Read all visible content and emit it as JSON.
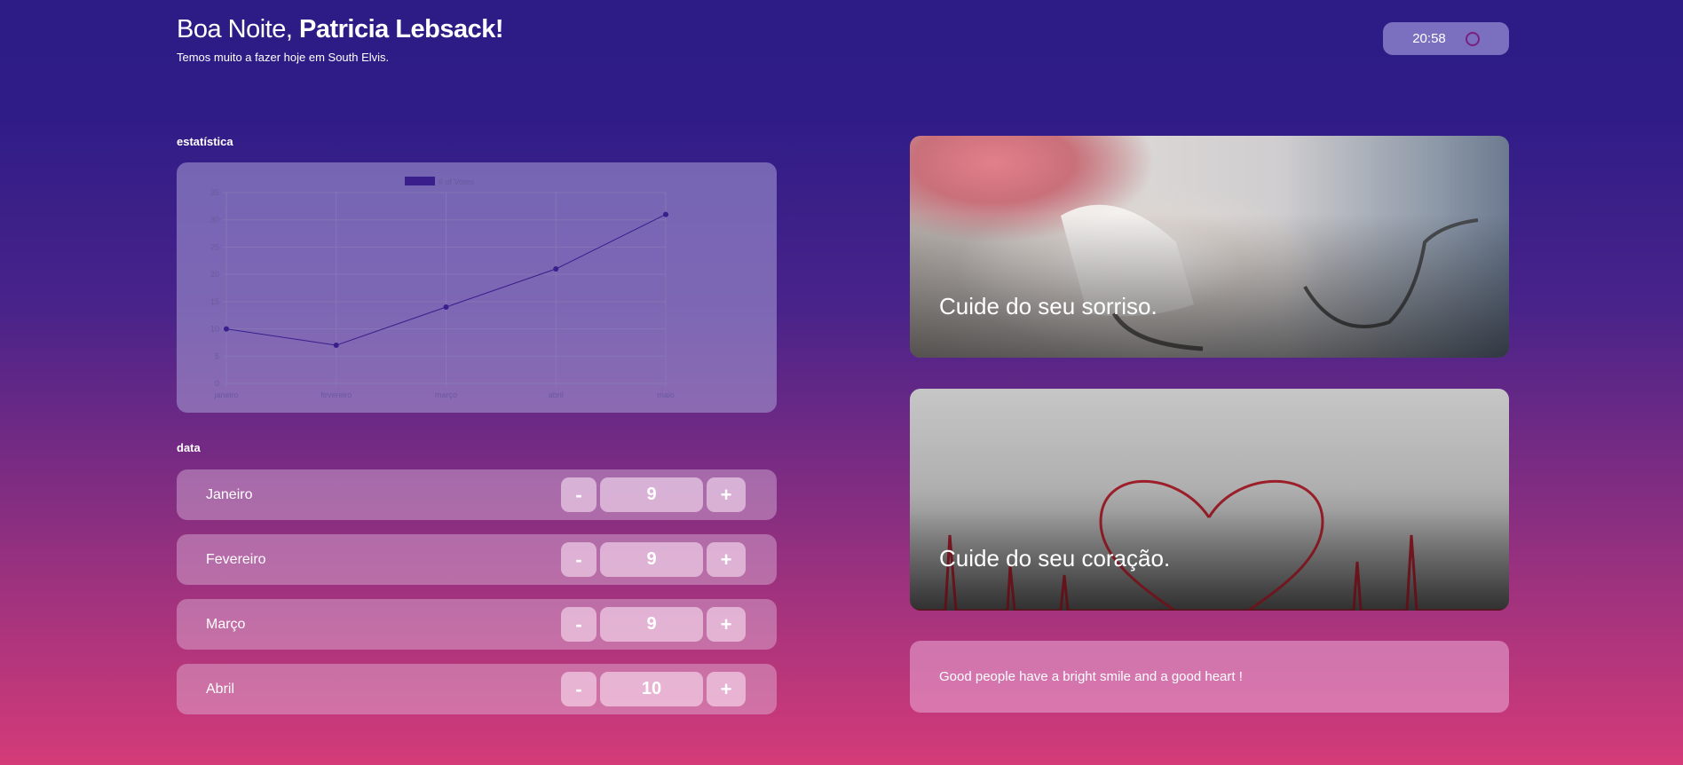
{
  "header": {
    "greeting_prefix": "Boa Noite, ",
    "user_name": "Patricia Lebsack!",
    "subtitle": "Temos muito a fazer hoje em South Elvis.",
    "time": "20:58"
  },
  "sections": {
    "stats_label": "estatística",
    "data_label": "data"
  },
  "chart_data": {
    "type": "line",
    "categories": [
      "janeiro",
      "fevereiro",
      "março",
      "abril",
      "maio"
    ],
    "series": [
      {
        "name": "# of Votes",
        "values": [
          10,
          7,
          14,
          21,
          31
        ]
      }
    ],
    "ylim": [
      0,
      35
    ],
    "yticks": [
      0,
      5,
      10,
      15,
      20,
      25,
      30,
      35
    ],
    "grid": true,
    "legend": "top-center",
    "colors": {
      "series": "#3a1e8c",
      "text": "#6b5aa0",
      "grid": "#8a7fb8"
    }
  },
  "counters": [
    {
      "label": "Janeiro",
      "value": "9",
      "minus": "-",
      "plus": "+"
    },
    {
      "label": "Fevereiro",
      "value": "9",
      "minus": "-",
      "plus": "+"
    },
    {
      "label": "Março",
      "value": "9",
      "minus": "-",
      "plus": "+"
    },
    {
      "label": "Abril",
      "value": "10",
      "minus": "-",
      "plus": "+"
    }
  ],
  "cards": {
    "smile_caption": "Cuide do seu sorriso.",
    "heart_caption": "Cuide do seu coração.",
    "quote": "Good people have a bright smile and a good heart !"
  },
  "icons": {
    "clock": "circle-icon"
  }
}
